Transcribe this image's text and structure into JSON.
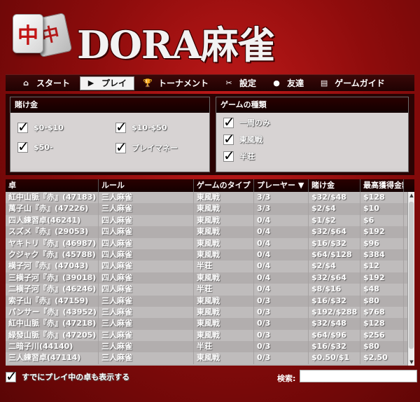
{
  "logo": {
    "tile_char": "中",
    "text": "DORA麻雀"
  },
  "nav": {
    "items": [
      {
        "label": "スタート",
        "icon": "home-icon",
        "glyph": "⌂"
      },
      {
        "label": "プレイ",
        "icon": "play-icon",
        "glyph": "▶",
        "active": true
      },
      {
        "label": "トーナメント",
        "icon": "trophy-icon",
        "glyph": "🏆"
      },
      {
        "label": "設定",
        "icon": "tools-icon",
        "glyph": "✂"
      },
      {
        "label": "友達",
        "icon": "person-icon",
        "glyph": "●"
      },
      {
        "label": "ゲームガイド",
        "icon": "book-icon",
        "glyph": "▤"
      }
    ]
  },
  "stakes": {
    "title": "賭け金",
    "options": [
      {
        "label": "$0-$10",
        "checked": true
      },
      {
        "label": "$10-$50",
        "checked": true
      },
      {
        "label": "$50-",
        "checked": true
      },
      {
        "label": "プレイマネー",
        "checked": true
      }
    ]
  },
  "game_type": {
    "title": "ゲームの種類",
    "options": [
      {
        "label": "一周のみ",
        "checked": true
      },
      {
        "label": "東風戦",
        "checked": true
      },
      {
        "label": "半荘",
        "checked": true
      }
    ]
  },
  "table": {
    "columns": [
      "卓",
      "ルール",
      "ゲームのタイプ",
      "プレーヤー ▼",
      "賭け金",
      "最高獲得金額"
    ],
    "rows": [
      [
        "紅中山脈『赤』(47183)",
        "三人麻雀",
        "東風戦",
        "3/3",
        "$32/$48",
        "$128"
      ],
      [
        "萬子山『赤』(47226)",
        "三人麻雀",
        "東風戦",
        "3/3",
        "$2/$4",
        "$10"
      ],
      [
        "四人練習卓(46241)",
        "四人麻雀",
        "東風戦",
        "0/4",
        "$1/$2",
        "$6"
      ],
      [
        "スズメ『赤』(29053)",
        "四人麻雀",
        "東風戦",
        "0/4",
        "$32/$64",
        "$192"
      ],
      [
        "ヤキトリ『赤』(46987)",
        "四人麻雀",
        "東風戦",
        "0/4",
        "$16/$32",
        "$96"
      ],
      [
        "クジャク『赤』(45788)",
        "四人麻雀",
        "東風戦",
        "0/4",
        "$64/$128",
        "$384"
      ],
      [
        "横子河『赤』(47043)",
        "四人麻雀",
        "半荘",
        "0/4",
        "$2/$4",
        "$12"
      ],
      [
        "三横子河『赤』(39018)",
        "四人麻雀",
        "東風戦",
        "0/4",
        "$32/$64",
        "$192"
      ],
      [
        "二横子河『赤』(46246)",
        "四人麻雀",
        "半荘",
        "0/4",
        "$8/$16",
        "$48"
      ],
      [
        "索子山『赤』(47159)",
        "三人麻雀",
        "東風戦",
        "0/3",
        "$16/$32",
        "$80"
      ],
      [
        "パンサー『赤』(43952)",
        "三人麻雀",
        "東風戦",
        "0/3",
        "$192/$288",
        "$768"
      ],
      [
        "紅中山脈『赤』(47218)",
        "三人麻雀",
        "東風戦",
        "0/3",
        "$32/$48",
        "$128"
      ],
      [
        "緑發山脈『赤』(47205)",
        "三人麻雀",
        "東風戦",
        "0/3",
        "$64/$96",
        "$256"
      ],
      [
        "二暗子川(44140)",
        "三人麻雀",
        "半荘",
        "0/3",
        "$16/$32",
        "$80"
      ],
      [
        "三人練習卓(47114)",
        "三人麻雀",
        "東風戦",
        "0/3",
        "$0.50/$1",
        "$2.50"
      ]
    ]
  },
  "footer": {
    "show_playing_label": "すでにプレイ中の卓も表示する",
    "show_playing_checked": true,
    "search_label": "検索:",
    "search_value": ""
  }
}
